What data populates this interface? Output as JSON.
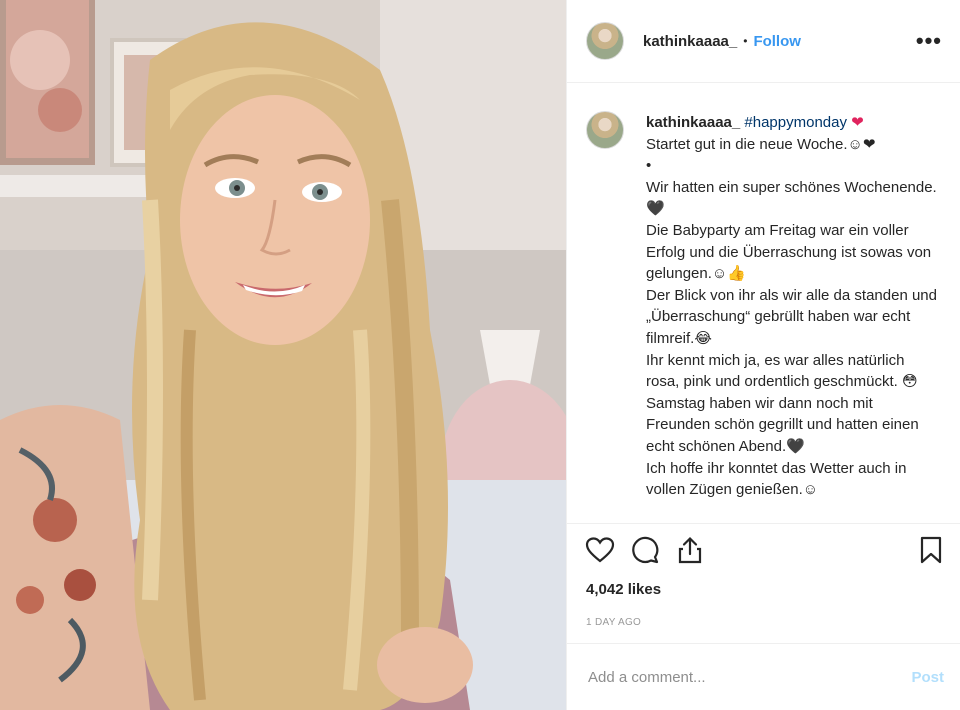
{
  "header": {
    "username": "kathinkaaaa_",
    "separator": "•",
    "follow_label": "Follow",
    "more_icon": "more-options-icon",
    "more_label": "•••"
  },
  "caption": {
    "username": "kathinkaaaa_",
    "hashtag": "#happymonday",
    "heart": "❤",
    "lines": [
      "Startet gut in die neue Woche.☺❤",
      "•",
      "Wir hatten ein super schönes Wochenende.🖤",
      "Die Babyparty am Freitag war ein voller Erfolg und die Überraschung ist sowas von gelungen.☺👍",
      "Der Blick von ihr als wir alle da standen und „Überraschung“ gebrüllt haben war echt filmreif.😂",
      "Ihr kennt mich ja, es war alles natürlich rosa, pink und ordentlich geschmückt. 😳",
      "Samstag haben wir dann noch mit Freunden schön gegrillt und hatten einen echt schönen Abend.🖤",
      "Ich hoffe ihr konntet das Wetter auch in vollen Zügen genießen.☺"
    ]
  },
  "actions": {
    "like_icon": "heart-icon",
    "comment_icon": "comment-icon",
    "share_icon": "share-icon",
    "save_icon": "bookmark-icon"
  },
  "likes": "4,042 likes",
  "timestamp": "1 DAY AGO",
  "comment_box": {
    "placeholder": "Add a comment...",
    "post_label": "Post"
  },
  "colors": {
    "accent": "#3897f0",
    "post_disabled": "#b2dffc",
    "hashtag": "#003569"
  }
}
